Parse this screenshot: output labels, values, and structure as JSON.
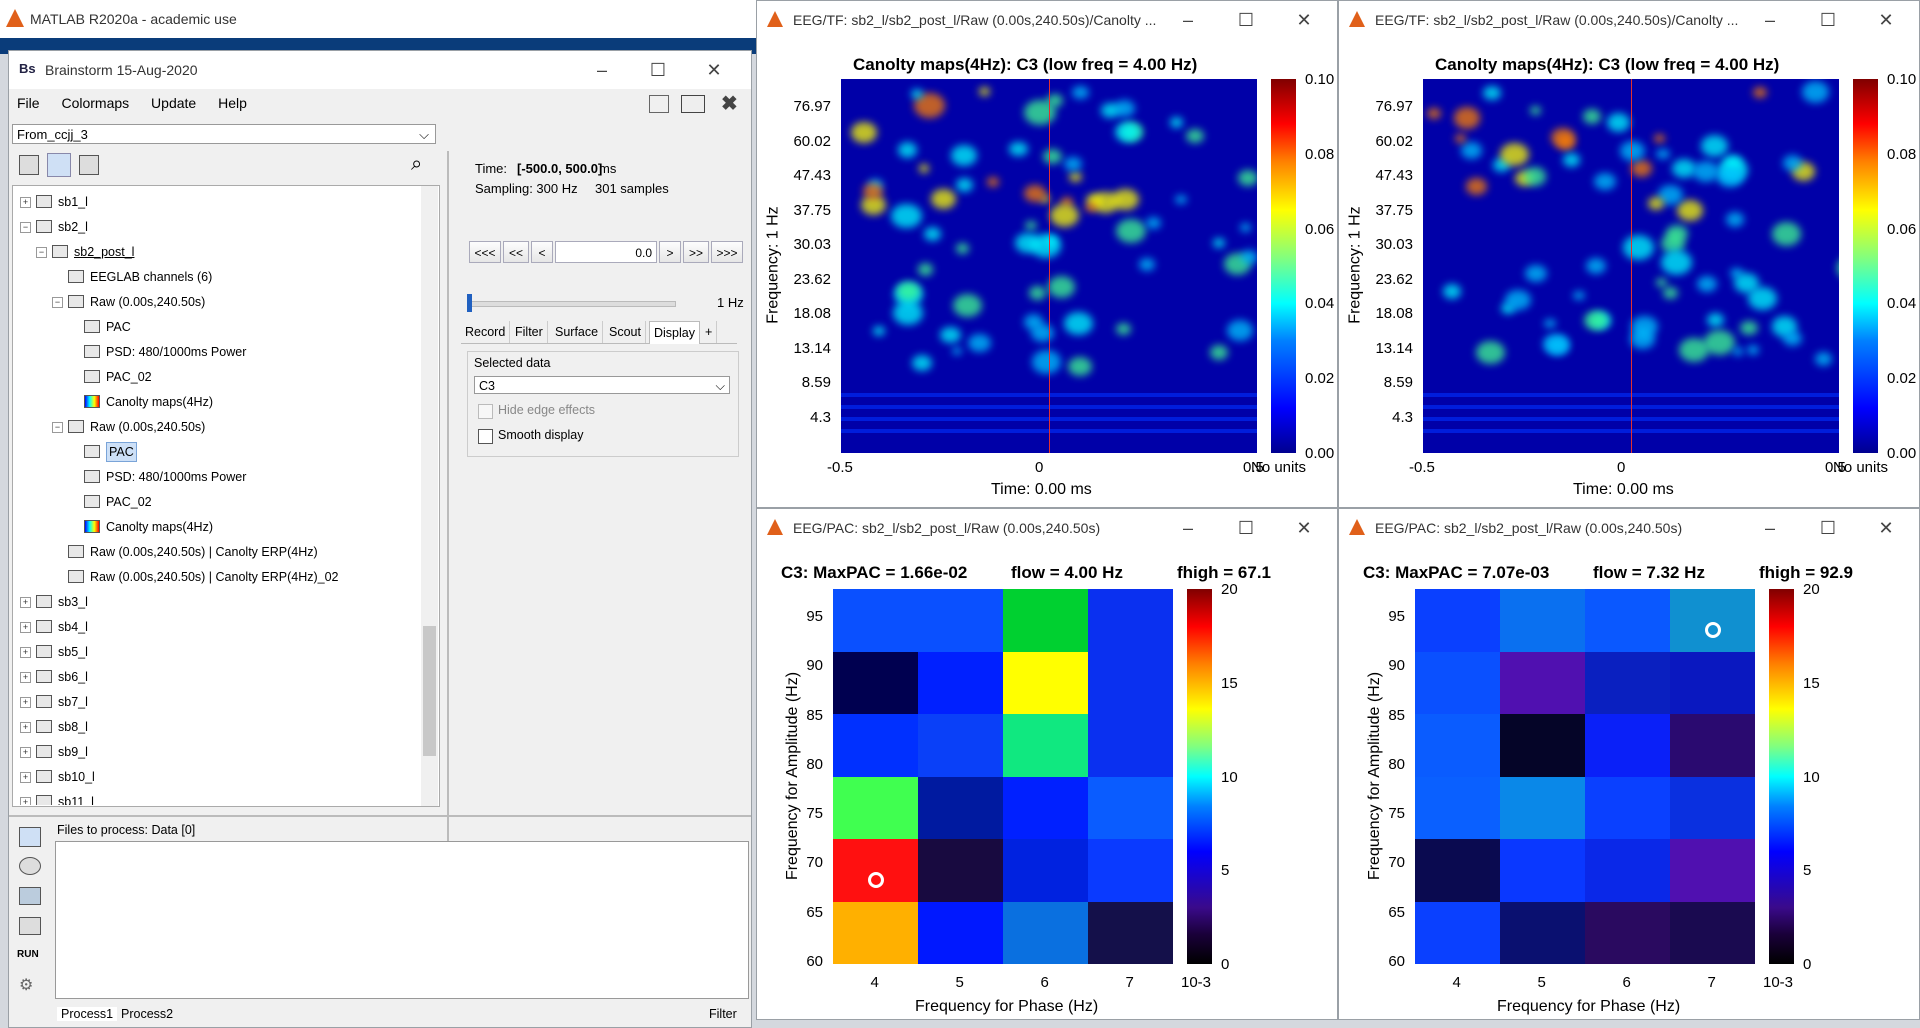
{
  "matlab": {
    "title": "MATLAB R2020a - academic use"
  },
  "brainstorm": {
    "title": "Brainstorm 15-Aug-2020",
    "menu": [
      "File",
      "Colormaps",
      "Update",
      "Help"
    ],
    "protocol": "From_ccjj_3",
    "tree": [
      {
        "label": "sb1_l"
      },
      {
        "label": "sb2_l"
      },
      {
        "label": "sb2_post_l"
      },
      {
        "label": "EEGLAB channels (6)"
      },
      {
        "label": "Raw (0.00s,240.50s)"
      },
      {
        "label": "PAC"
      },
      {
        "label": "PSD: 480/1000ms Power"
      },
      {
        "label": "PAC_02"
      },
      {
        "label": "Canolty maps(4Hz)"
      },
      {
        "label": "Raw (0.00s,240.50s)"
      },
      {
        "label": "PAC"
      },
      {
        "label": "PSD: 480/1000ms Power"
      },
      {
        "label": "PAC_02"
      },
      {
        "label": "Canolty maps(4Hz)"
      },
      {
        "label": "Raw (0.00s,240.50s) | Canolty ERP(4Hz)"
      },
      {
        "label": "Raw (0.00s,240.50s) | Canolty ERP(4Hz)_02"
      },
      {
        "label": "sb3_l"
      },
      {
        "label": "sb4_l"
      },
      {
        "label": "sb5_l"
      },
      {
        "label": "sb6_l"
      },
      {
        "label": "sb7_l"
      },
      {
        "label": "sb8_l"
      },
      {
        "label": "sb9_l"
      },
      {
        "label": "sb10_l"
      },
      {
        "label": "sb11_l"
      }
    ],
    "time_label": "Time:",
    "time_value": "[-500.0, 500.0]",
    "time_unit": "ms",
    "sampling": "Sampling: 300 Hz",
    "samples": "301 samples",
    "nav_buttons": [
      "<<<",
      "<<",
      "<",
      ">",
      ">>",
      ">>>"
    ],
    "time_input": "0.0",
    "freq_label": "1 Hz",
    "tabs": [
      "Record",
      "Filter",
      "Surface",
      "Scout",
      "Display",
      "+"
    ],
    "selected_data_label": "Selected data",
    "selected_data_value": "C3",
    "hide_edge": "Hide edge effects",
    "smooth": "Smooth display",
    "files_to_process": "Files to process: Data [0]",
    "run": "RUN",
    "bottom_tabs": [
      "Process1",
      "Process2"
    ],
    "filter": "Filter"
  },
  "tf_windows": [
    {
      "title": "EEG/TF: sb2_l/sb2_post_l/Raw (0.00s,240.50s)/Canolty ...",
      "plot_title": "Canolty maps(4Hz): C3    (low freq = 4.00 Hz)",
      "xlabel": "Time: 0.00 ms",
      "ylabel": "Frequency: 1 Hz",
      "cb_label": "No units"
    },
    {
      "title": "EEG/TF: sb2_l/sb2_post_l/Raw (0.00s,240.50s)/Canolty ...",
      "plot_title": "Canolty maps(4Hz): C3    (low freq = 4.00 Hz)",
      "xlabel": "Time: 0.00 ms",
      "ylabel": "Frequency: 1 Hz",
      "cb_label": "No units"
    }
  ],
  "tf_axes": {
    "yticks": [
      "76.97",
      "60.02",
      "47.43",
      "37.75",
      "30.03",
      "23.62",
      "18.08",
      "13.14",
      "8.59",
      "4.3"
    ],
    "xticks": [
      "-0.5",
      "0",
      "0.5"
    ],
    "cbticks": [
      "0.10",
      "0.08",
      "0.06",
      "0.04",
      "0.02",
      "0.00"
    ]
  },
  "pac_windows": [
    {
      "title": "EEG/PAC: sb2_l/sb2_post_l/Raw (0.00s,240.50s)",
      "plot_title_a": "C3: MaxPAC = 1.66e-02",
      "plot_title_b": "flow = 4.00 Hz",
      "plot_title_c": "fhigh = 67.1",
      "cells": [
        "#0a50ff",
        "#0a50ff",
        "#00d030",
        "#0a30f0",
        "#000050",
        "#0020ff",
        "#ffff00",
        "#0a30f0",
        "#0030ff",
        "#0a40f8",
        "#10e880",
        "#0a30f0",
        "#40ff50",
        "#001aa0",
        "#0020ff",
        "#0a5cff",
        "#ff1010",
        "#180a40",
        "#0022e0",
        "#0a3aff",
        "#ffb000",
        "#0018ff",
        "#0a70e0",
        "#14104a"
      ],
      "marker": {
        "col": 0,
        "row": 4
      }
    },
    {
      "title": "EEG/PAC: sb2_l/sb2_post_l/Raw (0.00s,240.50s)",
      "plot_title_a": "C3: MaxPAC = 7.07e-03",
      "plot_title_b": "flow = 7.32 Hz",
      "plot_title_c": "fhigh = 92.9",
      "cells": [
        "#0a40ff",
        "#0a70f0",
        "#0a58ff",
        "#1090d0",
        "#0a50ff",
        "#5010b0",
        "#0a20c0",
        "#0a18c0",
        "#0a5cff",
        "#050528",
        "#0a20f8",
        "#2a0a70",
        "#0a60ff",
        "#0a88e8",
        "#0a40ff",
        "#0a30e0",
        "#0a0a50",
        "#0a38ff",
        "#0a28e8",
        "#5010b0",
        "#0a40ff",
        "#0a1070",
        "#2a0a60",
        "#1a0a50"
      ],
      "marker": {
        "col": 3,
        "row": 0
      }
    }
  ],
  "pac_axes": {
    "yticks": [
      "95",
      "90",
      "85",
      "80",
      "75",
      "70",
      "65",
      "60"
    ],
    "xticks": [
      "4",
      "5",
      "6",
      "7"
    ],
    "cbticks": [
      "20",
      "15",
      "10",
      "5",
      "0"
    ],
    "exp": "10-3",
    "xlabel": "Frequency for Phase (Hz)",
    "ylabel": "Frequency for Amplitude (Hz)"
  }
}
